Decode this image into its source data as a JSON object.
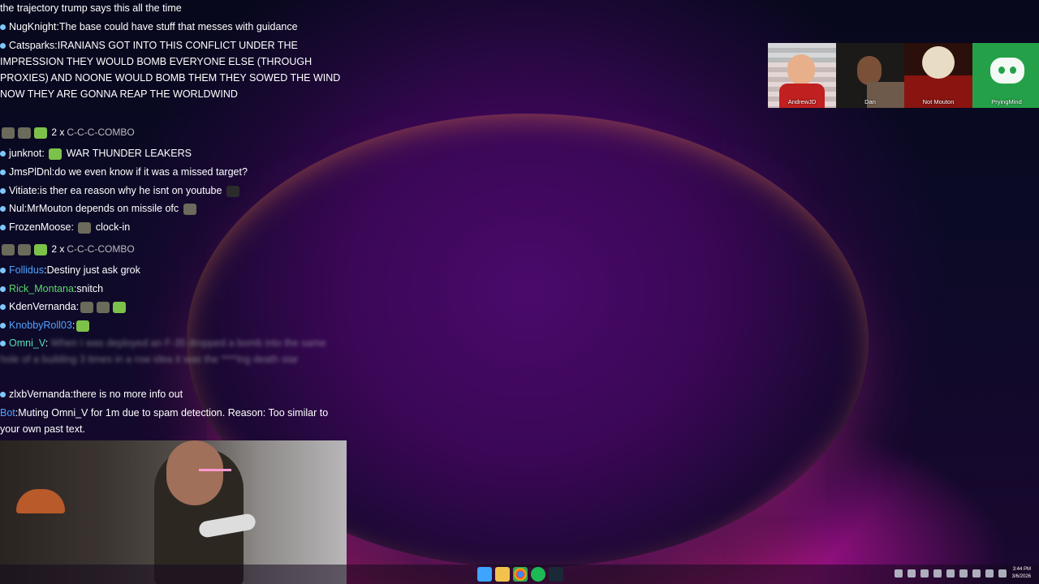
{
  "chat": {
    "messages": [
      {
        "type": "text",
        "user": "",
        "text": "the trajectory trump says this all the time"
      },
      {
        "type": "msg",
        "user": "NugKnight",
        "text": "The base could have stuff that messes with guidance"
      },
      {
        "type": "msg",
        "user": "Catsparks",
        "text": "IRANIANS GOT INTO THIS CONFLICT UNDER THE IMPRESSION THEY WOULD BOMB EVERYONE ELSE (THROUGH PROXIES) AND NOONE WOULD BOMB THEM  THEY SOWED THE WIND  NOW THEY ARE GONNA REAP THE WORLDWIND"
      },
      {
        "type": "combo",
        "count": "2 x",
        "label": "C-C-C-COMBO"
      },
      {
        "type": "msg",
        "user": "junknot",
        "text": "WAR THUNDER LEAKERS"
      },
      {
        "type": "msg",
        "user": "JmsPlDnl",
        "text": "do we even know if it was a missed target?"
      },
      {
        "type": "msg",
        "user": "Vitiate",
        "text": "is ther ea reason why he isnt on youtube"
      },
      {
        "type": "msg",
        "user": "Nul",
        "text": "MrMouton depends on missile ofc"
      },
      {
        "type": "msg",
        "user": "FrozenMoose",
        "text": "clock-in"
      },
      {
        "type": "combo",
        "count": "2 x",
        "label": "C-C-C-COMBO"
      },
      {
        "type": "msg",
        "user": "Follidus",
        "text": "Destiny just ask grok"
      },
      {
        "type": "msg",
        "user": "Rick_Montana",
        "text": "snitch"
      },
      {
        "type": "msg",
        "user": "KdenVernanda",
        "text": ""
      },
      {
        "type": "msg",
        "user": "KnobbyRoll03",
        "text": ""
      },
      {
        "type": "msg",
        "user": "Omni_V",
        "text": "When I was deployed an F-35 dropped a bomb into the same hole of a building 3 times in a row idea it was the ****ing death star"
      },
      {
        "type": "msg",
        "user": "zlxbVernanda",
        "text": "there is no more info out"
      },
      {
        "type": "msg",
        "user": "Bot",
        "text": "Muting Omni_V for 1m due to spam detection. Reason: Too similar to your own past text."
      }
    ]
  },
  "cams": [
    {
      "name": "AndrewJD"
    },
    {
      "name": "Dan"
    },
    {
      "name": "Not Mouton"
    },
    {
      "name": "PryingMind"
    }
  ],
  "taskbar": {
    "time": "3:44 PM",
    "date": "3/6/2026"
  },
  "colors": {
    "accent": "#4fa3ff",
    "green": "#5bd86a"
  }
}
